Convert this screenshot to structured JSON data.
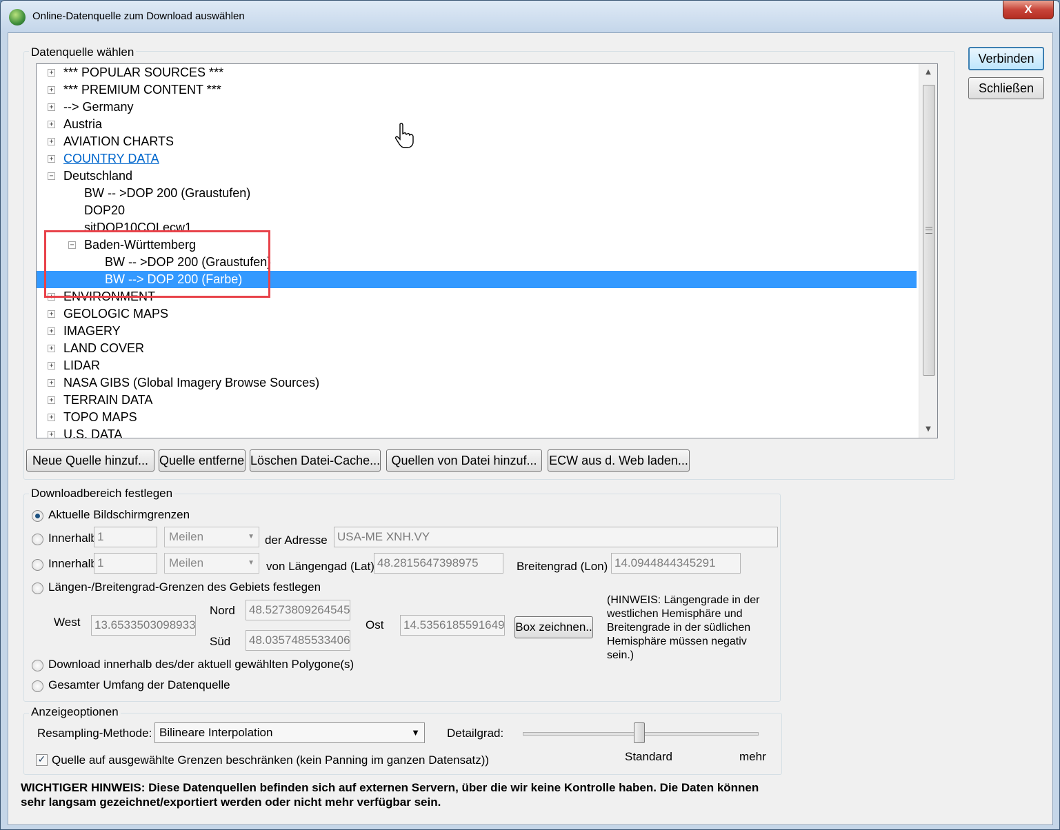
{
  "window": {
    "title": "Online-Datenquelle zum Download auswählen",
    "close_label": "X"
  },
  "datasource": {
    "group_label": "Datenquelle wählen",
    "tree": [
      {
        "label": "*** POPULAR SOURCES ***",
        "expander": "+"
      },
      {
        "label": "*** PREMIUM CONTENT ***",
        "expander": "+"
      },
      {
        "label": "--> Germany",
        "expander": "+"
      },
      {
        "label": "Austria",
        "expander": "+"
      },
      {
        "label": "AVIATION CHARTS",
        "expander": "+"
      },
      {
        "label": "COUNTRY DATA",
        "expander": "+"
      },
      {
        "label": "Deutschland",
        "expander": "−"
      },
      {
        "label": "BW -- >DOP 200 (Graustufen)"
      },
      {
        "label": "DOP20"
      },
      {
        "label": "sitDOP10COLecw1"
      },
      {
        "label": "Baden-Württemberg",
        "expander": "−"
      },
      {
        "label": "BW -- >DOP 200 (Graustufen)"
      },
      {
        "label": "BW --> DOP 200 (Farbe)"
      },
      {
        "label": "ENVIRONMENT",
        "expander": "+"
      },
      {
        "label": "GEOLOGIC MAPS",
        "expander": "+"
      },
      {
        "label": "IMAGERY",
        "expander": "+"
      },
      {
        "label": "LAND COVER",
        "expander": "+"
      },
      {
        "label": "LIDAR",
        "expander": "+"
      },
      {
        "label": "NASA GIBS (Global Imagery Browse Sources)",
        "expander": "+"
      },
      {
        "label": "TERRAIN DATA",
        "expander": "+"
      },
      {
        "label": "TOPO MAPS",
        "expander": "+"
      },
      {
        "label": "U.S. DATA",
        "expander": "+"
      }
    ],
    "buttons": {
      "add_source": "Neue Quelle hinzuf...",
      "remove_source": "Quelle entfernen",
      "clear_cache": "Löschen Datei-Cache...",
      "add_from_file": "Quellen von Datei hinzuf...",
      "load_ecw": "ECW aus d. Web laden..."
    }
  },
  "side_buttons": {
    "connect": "Verbinden",
    "close": "Schließen"
  },
  "download_area": {
    "group_label": "Downloadbereich festlegen",
    "opt_screen": "Aktuelle Bildschirmgrenzen",
    "opt_within_address": "Innerhalb",
    "address_distance": "1",
    "address_unit": "Meilen",
    "address_label": "der Adresse",
    "address_value": "USA-ME XNH.VY",
    "opt_within_latlon": "Innerhalb",
    "latlon_distance": "1",
    "latlon_unit": "Meilen",
    "lat_label": "von Längengad (Lat)",
    "lat_value": "48.2815647398975",
    "lon_label": "Breitengrad (Lon)",
    "lon_value": "14.0944844345291",
    "opt_bounds": "Längen-/Breitengrad-Grenzen des Gebiets festlegen",
    "west_label": "West",
    "west_value": "13.6533503098933",
    "north_label": "Nord",
    "north_value": "48.5273809264545",
    "south_label": "Süd",
    "south_value": "48.0357485533406",
    "east_label": "Ost",
    "east_value": "14.5356185591649",
    "draw_box_button": "Box zeichnen..",
    "hint": "(HINWEIS: Längengrade in der westlichen Hemisphäre und Breitengrade in der südlichen Hemisphäre müssen negativ sein.)",
    "opt_polygon": "Download innerhalb des/der aktuell gewählten Polygone(s)",
    "opt_full_extent": "Gesamter Umfang der Datenquelle"
  },
  "display_options": {
    "group_label": "Anzeigeoptionen",
    "resampling_label": "Resampling-Methode:",
    "resampling_value": "Bilineare Interpolation",
    "detail_label": "Detailgrad:",
    "slider_standard": "Standard",
    "slider_more": "mehr",
    "restrict_label": "Quelle auf ausgewählte Grenzen beschränken (kein Panning im ganzen Datensatz))",
    "restrict_checked": true
  },
  "warning": "WICHTIGER HINWEIS: Diese Datenquellen befinden sich auf externen Servern, über die wir keine Kontrolle haben. Die Daten können sehr langsam gezeichnet/exportiert werden oder nicht mehr verfügbar sein.",
  "colors": {
    "selection": "#3399ff",
    "highlight_box": "#e8424a",
    "link": "#0066cc"
  }
}
